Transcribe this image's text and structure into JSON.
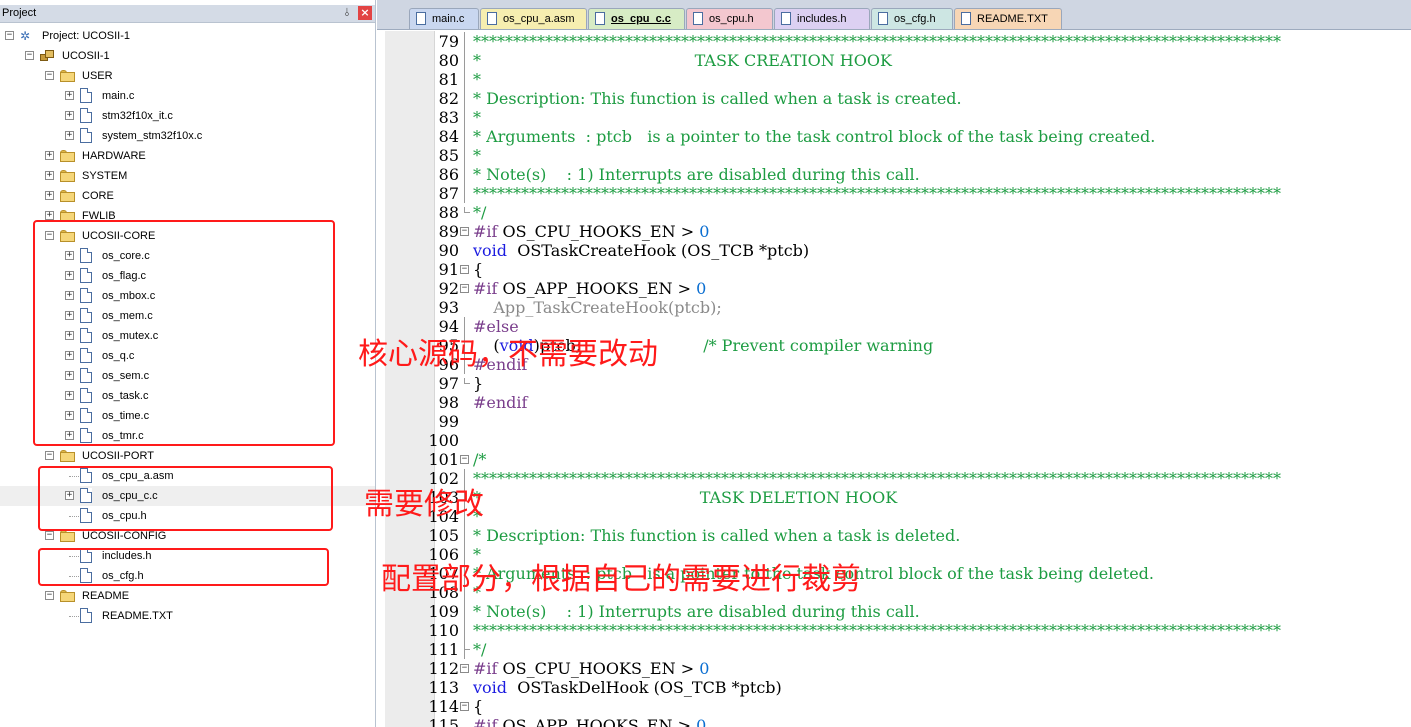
{
  "project_panel": {
    "title": "Project",
    "pin_glyph": "⫰",
    "close_glyph": "×",
    "tree": [
      {
        "label": "Project: UCOSII-1",
        "depth": 0,
        "kind": "project",
        "toggle": "−"
      },
      {
        "label": "UCOSII-1",
        "depth": 1,
        "kind": "target",
        "toggle": "−"
      },
      {
        "label": "USER",
        "depth": 2,
        "kind": "folder",
        "toggle": "−"
      },
      {
        "label": "main.c",
        "depth": 3,
        "kind": "file",
        "toggle": "+"
      },
      {
        "label": "stm32f10x_it.c",
        "depth": 3,
        "kind": "file",
        "toggle": "+"
      },
      {
        "label": "system_stm32f10x.c",
        "depth": 3,
        "kind": "file",
        "toggle": "+"
      },
      {
        "label": "HARDWARE",
        "depth": 2,
        "kind": "folder",
        "toggle": "+"
      },
      {
        "label": "SYSTEM",
        "depth": 2,
        "kind": "folder",
        "toggle": "+"
      },
      {
        "label": "CORE",
        "depth": 2,
        "kind": "folder",
        "toggle": "+"
      },
      {
        "label": "FWLIB",
        "depth": 2,
        "kind": "folder",
        "toggle": "+"
      },
      {
        "label": "UCOSII-CORE",
        "depth": 2,
        "kind": "folder",
        "toggle": "−"
      },
      {
        "label": "os_core.c",
        "depth": 3,
        "kind": "file",
        "toggle": "+"
      },
      {
        "label": "os_flag.c",
        "depth": 3,
        "kind": "file",
        "toggle": "+"
      },
      {
        "label": "os_mbox.c",
        "depth": 3,
        "kind": "file",
        "toggle": "+"
      },
      {
        "label": "os_mem.c",
        "depth": 3,
        "kind": "file",
        "toggle": "+"
      },
      {
        "label": "os_mutex.c",
        "depth": 3,
        "kind": "file",
        "toggle": "+"
      },
      {
        "label": "os_q.c",
        "depth": 3,
        "kind": "file",
        "toggle": "+"
      },
      {
        "label": "os_sem.c",
        "depth": 3,
        "kind": "file",
        "toggle": "+"
      },
      {
        "label": "os_task.c",
        "depth": 3,
        "kind": "file",
        "toggle": "+"
      },
      {
        "label": "os_time.c",
        "depth": 3,
        "kind": "file",
        "toggle": "+"
      },
      {
        "label": "os_tmr.c",
        "depth": 3,
        "kind": "file",
        "toggle": "+"
      },
      {
        "label": "UCOSII-PORT",
        "depth": 2,
        "kind": "folder",
        "toggle": "−"
      },
      {
        "label": "os_cpu_a.asm",
        "depth": 3,
        "kind": "file",
        "toggle": ""
      },
      {
        "label": "os_cpu_c.c",
        "depth": 3,
        "kind": "file",
        "toggle": "+",
        "selected": true
      },
      {
        "label": "os_cpu.h",
        "depth": 3,
        "kind": "file",
        "toggle": ""
      },
      {
        "label": "UCOSII-CONFIG",
        "depth": 2,
        "kind": "folder",
        "toggle": "−"
      },
      {
        "label": "includes.h",
        "depth": 3,
        "kind": "file",
        "toggle": ""
      },
      {
        "label": "os_cfg.h",
        "depth": 3,
        "kind": "file",
        "toggle": ""
      },
      {
        "label": "README",
        "depth": 2,
        "kind": "folder",
        "toggle": "−"
      },
      {
        "label": "README.TXT",
        "depth": 3,
        "kind": "file",
        "toggle": ""
      }
    ]
  },
  "tabs": [
    {
      "label": "main.c",
      "color": "#c9d7f0",
      "active": false
    },
    {
      "label": "os_cpu_a.asm",
      "color": "#f6eeb0",
      "active": false
    },
    {
      "label": "os_cpu_c.c",
      "color": "#d7ecc5",
      "active": true
    },
    {
      "label": "os_cpu.h",
      "color": "#f3c7cf",
      "active": false
    },
    {
      "label": "includes.h",
      "color": "#dcd0f2",
      "active": false
    },
    {
      "label": "os_cfg.h",
      "color": "#cde6e3",
      "active": false
    },
    {
      "label": "README.TXT",
      "color": "#f7d6b5",
      "active": false
    }
  ],
  "editor": {
    "lines": [
      {
        "n": "79",
        "segs": [
          [
            "c",
            "*****************************************************************************************************"
          ]
        ]
      },
      {
        "n": "80",
        "segs": [
          [
            "c",
            "*                                          TASK CREATION HOOK"
          ]
        ]
      },
      {
        "n": "81",
        "segs": [
          [
            "c",
            "*"
          ]
        ]
      },
      {
        "n": "82",
        "segs": [
          [
            "c",
            "* Description: This function is called when a task is created."
          ]
        ]
      },
      {
        "n": "83",
        "segs": [
          [
            "c",
            "*"
          ]
        ]
      },
      {
        "n": "84",
        "segs": [
          [
            "c",
            "* Arguments  : ptcb   is a pointer to the task control block of the task being created."
          ]
        ]
      },
      {
        "n": "85",
        "segs": [
          [
            "c",
            "*"
          ]
        ]
      },
      {
        "n": "86",
        "segs": [
          [
            "c",
            "* Note(s)    : 1) Interrupts are disabled during this call."
          ]
        ]
      },
      {
        "n": "87",
        "segs": [
          [
            "c",
            "*****************************************************************************************************"
          ]
        ]
      },
      {
        "n": "88",
        "segs": [
          [
            "c",
            "*/"
          ]
        ]
      },
      {
        "n": "89",
        "segs": [
          [
            "p",
            "#if "
          ],
          [
            "t",
            "OS_CPU_HOOKS_EN > "
          ],
          [
            "n",
            "0"
          ]
        ]
      },
      {
        "n": "90",
        "segs": [
          [
            "k",
            "void"
          ],
          [
            "t",
            "  OSTaskCreateHook (OS_TCB *ptcb)"
          ]
        ]
      },
      {
        "n": "91",
        "segs": [
          [
            "t",
            "{"
          ]
        ]
      },
      {
        "n": "92",
        "segs": [
          [
            "p",
            "#if "
          ],
          [
            "t",
            "OS_APP_HOOKS_EN > "
          ],
          [
            "n",
            "0"
          ]
        ]
      },
      {
        "n": "93",
        "segs": [
          [
            "g",
            "    App_TaskCreateHook(ptcb);"
          ]
        ]
      },
      {
        "n": "94",
        "segs": [
          [
            "p",
            "#else"
          ]
        ]
      },
      {
        "n": "95",
        "segs": [
          [
            "t",
            "    ("
          ],
          [
            "k",
            "void"
          ],
          [
            "t",
            ")ptcb;                        "
          ],
          [
            "c",
            "/* Prevent compiler warning"
          ]
        ]
      },
      {
        "n": "96",
        "segs": [
          [
            "p",
            "#endif"
          ]
        ]
      },
      {
        "n": "97",
        "segs": [
          [
            "t",
            "}"
          ]
        ]
      },
      {
        "n": "98",
        "segs": [
          [
            "p",
            "#endif"
          ]
        ]
      },
      {
        "n": "99",
        "segs": []
      },
      {
        "n": "100",
        "segs": []
      },
      {
        "n": "101",
        "segs": [
          [
            "c",
            "/*"
          ]
        ]
      },
      {
        "n": "102",
        "segs": [
          [
            "c",
            "*****************************************************************************************************"
          ]
        ]
      },
      {
        "n": "103",
        "segs": [
          [
            "c",
            "*                                           TASK DELETION HOOK"
          ]
        ]
      },
      {
        "n": "104",
        "segs": [
          [
            "c",
            "*"
          ]
        ]
      },
      {
        "n": "105",
        "segs": [
          [
            "c",
            "* Description: This function is called when a task is deleted."
          ]
        ]
      },
      {
        "n": "106",
        "segs": [
          [
            "c",
            "*"
          ]
        ]
      },
      {
        "n": "107",
        "segs": [
          [
            "c",
            "* Arguments  : ptcb   is a pointer to the task control block of the task being deleted."
          ]
        ]
      },
      {
        "n": "108",
        "segs": [
          [
            "c",
            "*"
          ]
        ]
      },
      {
        "n": "109",
        "segs": [
          [
            "c",
            "* Note(s)    : 1) Interrupts are disabled during this call."
          ]
        ]
      },
      {
        "n": "110",
        "segs": [
          [
            "c",
            "*****************************************************************************************************"
          ]
        ]
      },
      {
        "n": "111",
        "segs": [
          [
            "c",
            "*/"
          ]
        ]
      },
      {
        "n": "112",
        "segs": [
          [
            "p",
            "#if "
          ],
          [
            "t",
            "OS_CPU_HOOKS_EN > "
          ],
          [
            "n",
            "0"
          ]
        ]
      },
      {
        "n": "113",
        "segs": [
          [
            "k",
            "void"
          ],
          [
            "t",
            "  OSTaskDelHook (OS_TCB *ptcb)"
          ]
        ]
      },
      {
        "n": "114",
        "segs": [
          [
            "t",
            "{"
          ]
        ]
      },
      {
        "n": "115",
        "segs": [
          [
            "p",
            "#if "
          ],
          [
            "t",
            "OS_APP_HOOKS_EN > "
          ],
          [
            "n",
            "0"
          ]
        ]
      }
    ]
  },
  "annotations": {
    "core": "核心源码，不需要改动",
    "port": "需要修改",
    "config": "配置部分，根据自己的需要进行裁剪"
  },
  "colors": {
    "annotation": "#ff1a1a",
    "comment": "#1d9c42",
    "preprocessor": "#7a3e8c",
    "keyword": "#1c1ce0",
    "number": "#0a6ed1"
  }
}
